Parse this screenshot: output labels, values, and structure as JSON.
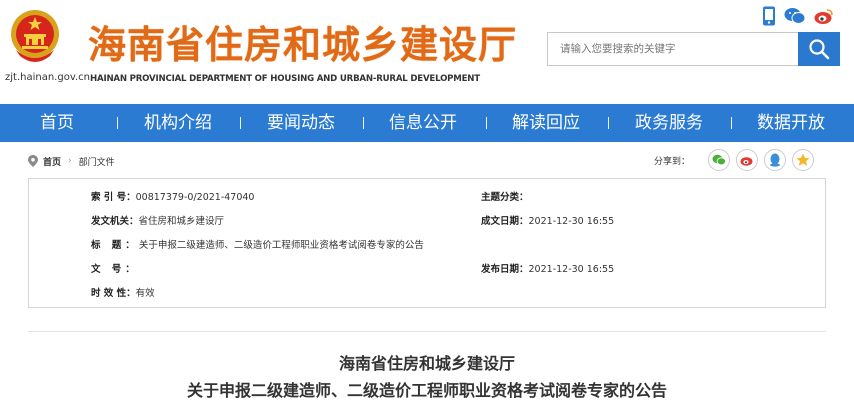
{
  "header": {
    "site_title": "海南省住房和城乡建设厅",
    "site_subtitle": "HAINAN PROVINCIAL DEPARTMENT OF HOUSING AND URBAN-RURAL DEVELOPMENT",
    "site_url": "zjt.hainan.gov.cn",
    "search_placeholder": "请输入您要搜索的关键字",
    "brand_color": "#e06a17",
    "accent_color": "#2a7bd1",
    "top_icons": [
      "mobile-icon",
      "wechat-icon",
      "weibo-icon"
    ]
  },
  "nav": {
    "items": [
      {
        "label": "首页"
      },
      {
        "label": "机构介绍"
      },
      {
        "label": "要闻动态"
      },
      {
        "label": "信息公开"
      },
      {
        "label": "解读回应"
      },
      {
        "label": "政务服务"
      },
      {
        "label": "数据开放"
      }
    ]
  },
  "breadcrumb": {
    "home": "首页",
    "current": "部门文件"
  },
  "share": {
    "label": "分享到：",
    "targets": [
      "wechat-icon",
      "weibo-icon",
      "qq-icon",
      "qzone-icon"
    ]
  },
  "info": {
    "index_label": "索 引 号：",
    "index_value": "00817379-0/2021-47040",
    "category_label": "主题分类：",
    "category_value": "",
    "issuer_label": "发文机关：",
    "issuer_value": "省住房和城乡建设厅",
    "created_label": "成文日期：",
    "created_value": "2021-12-30 16:55",
    "title_label": "标 题：",
    "title_value": "关于申报二级建造师、二级造价工程师职业资格考试阅卷专家的公告",
    "docno_label": "文 号：",
    "docno_value": "",
    "published_label": "发布日期：",
    "published_value": "2021-12-30 16:55",
    "validity_label": "时 效 性：",
    "validity_value": "有效"
  },
  "article": {
    "title_line1": "海南省住房和城乡建设厅",
    "title_line2": "关于申报二级建造师、二级造价工程师职业资格考试阅卷专家的公告"
  }
}
